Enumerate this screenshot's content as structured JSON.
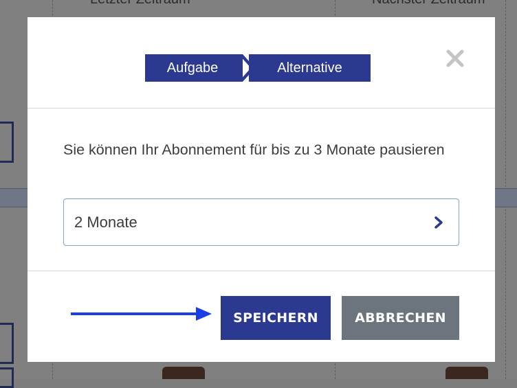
{
  "background": {
    "left_heading": "Letzter Zeitraum",
    "right_heading": "Nächster Zeitraum"
  },
  "modal": {
    "steps": [
      {
        "label": "Aufgabe"
      },
      {
        "label": "Alternative"
      }
    ],
    "close_icon": "close-icon",
    "prompt": "Sie können Ihr Abonnement für bis zu 3 Monate pausieren",
    "duration_select": {
      "value": "2 Monate",
      "icon": "chevron-right-icon"
    },
    "save_label": "SPEICHERN",
    "cancel_label": "ABBRECHEN"
  },
  "colors": {
    "primary": "#2b3990",
    "cancel": "#6c757d",
    "arrow": "#1a3ee6",
    "overlay": "#808080"
  }
}
